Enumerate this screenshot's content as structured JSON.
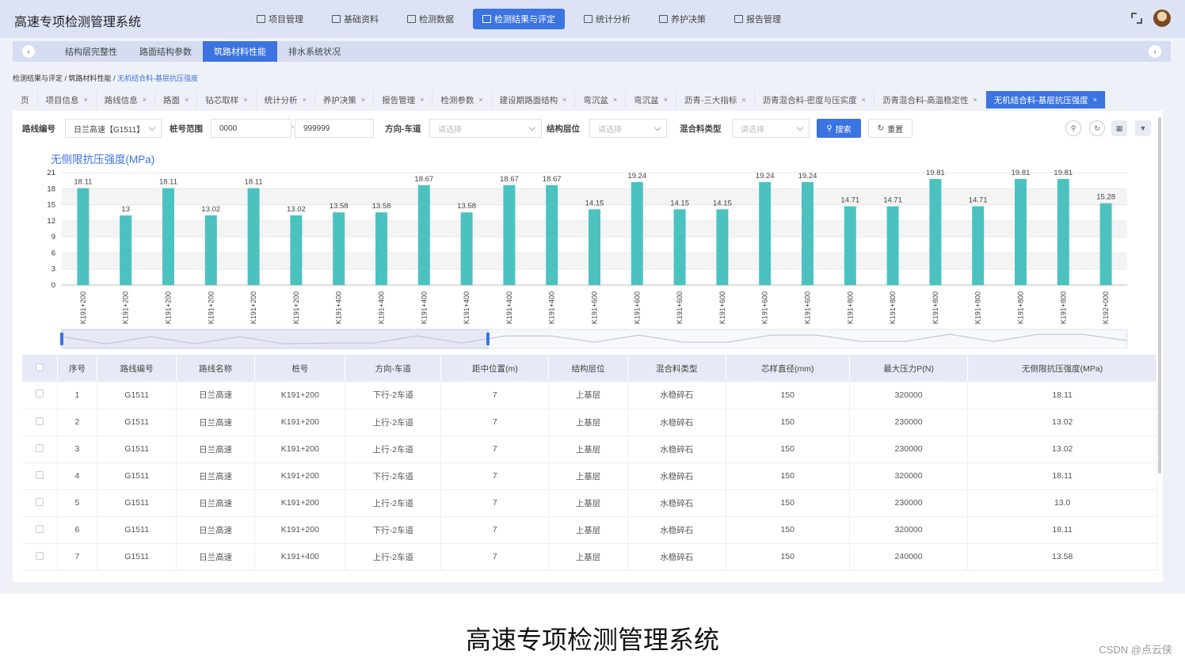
{
  "app": {
    "title": "高速专项检测管理系统",
    "nav": [
      {
        "label": "项目管理"
      },
      {
        "label": "基础资料"
      },
      {
        "label": "检测数据"
      },
      {
        "label": "检测结果与评定",
        "active": true
      },
      {
        "label": "统计分析"
      },
      {
        "label": "养护决策"
      },
      {
        "label": "报告管理"
      }
    ]
  },
  "subnav": {
    "tabs": [
      {
        "label": "结构层完整性"
      },
      {
        "label": "路面结构参数"
      },
      {
        "label": "筑路材料性能",
        "active": true
      },
      {
        "label": "排水系统状况"
      }
    ]
  },
  "breadcrumb": {
    "part1": "检测结果与评定",
    "part2": "筑路材料性能",
    "current": "无机结合料-基层抗压强度",
    "sep": " / "
  },
  "page_tabs": [
    {
      "label": "页",
      "closable": false
    },
    {
      "label": "项目信息"
    },
    {
      "label": "路线信息"
    },
    {
      "label": "路面"
    },
    {
      "label": "钻芯取样"
    },
    {
      "label": "统计分析"
    },
    {
      "label": "养护决策"
    },
    {
      "label": "报告管理"
    },
    {
      "label": "检测参数"
    },
    {
      "label": "建设期路面结构"
    },
    {
      "label": "弯沉盆"
    },
    {
      "label": "弯沉盆"
    },
    {
      "label": "沥青-三大指标"
    },
    {
      "label": "沥青混合料-密度与压实度"
    },
    {
      "label": "沥青混合料-高温稳定性"
    },
    {
      "label": "无机结合料-基层抗压强度",
      "active": true
    }
  ],
  "filters": {
    "route_label": "路线编号",
    "route_value": "日兰高速【G1511】",
    "stake_label": "桩号范围",
    "stake_from": "0000",
    "stake_to": "999999",
    "stake_dash": "-",
    "direction_label": "方向-车道",
    "direction_placeholder": "请选择",
    "layer_label": "结构层位",
    "layer_placeholder": "请选择",
    "mix_label": "混合料类型",
    "mix_placeholder": "请选择",
    "search_label": "搜索",
    "reset_label": "重置"
  },
  "chart_data": {
    "type": "bar",
    "title": "无侧限抗压强度(MPa)",
    "color": "#4cc2c0",
    "ylim": [
      0,
      21
    ],
    "yticks": [
      0,
      3,
      6,
      9,
      12,
      15,
      18,
      21
    ],
    "grid": true,
    "categories": [
      "K191+200",
      "K191+200",
      "K191+200",
      "K191+200",
      "K191+200",
      "K191+200",
      "K191+400",
      "K191+400",
      "K191+400",
      "K191+400",
      "K191+400",
      "K191+400",
      "K191+600",
      "K191+600",
      "K191+600",
      "K191+600",
      "K191+600",
      "K191+600",
      "K191+800",
      "K191+800",
      "K191+800",
      "K191+800",
      "K191+800",
      "K191+800",
      "K192+000"
    ],
    "values": [
      18.11,
      13,
      18.11,
      13.02,
      18.11,
      13.02,
      13.58,
      13.58,
      18.67,
      13.58,
      18.67,
      18.67,
      14.15,
      19.24,
      14.15,
      14.15,
      19.24,
      19.24,
      14.71,
      14.71,
      19.81,
      14.71,
      19.81,
      19.81,
      15.28
    ],
    "labels": [
      "18.11",
      "13",
      "18.11",
      "13.02",
      "18.11",
      "13.02",
      "13.58",
      "13.58",
      "18.67",
      "13.58",
      "18.67",
      "18.67",
      "14.15",
      "19.24",
      "14.15",
      "14.15",
      "19.24",
      "19.24",
      "14.71",
      "14.71",
      "19.81",
      "14.71",
      "19.81",
      "19.81",
      "15.28"
    ],
    "datazoom_range": [
      0,
      0.4
    ]
  },
  "table": {
    "columns": [
      "序号",
      "路线编号",
      "路线名称",
      "桩号",
      "方向-车道",
      "距中位置(m)",
      "结构层位",
      "混合料类型",
      "芯样直径(mm)",
      "最大压力P(N)",
      "无侧限抗压强度(MPa)"
    ],
    "rows": [
      [
        "1",
        "G1511",
        "日兰高速",
        "K191+200",
        "下行-2车道",
        "7",
        "上基层",
        "水稳碎石",
        "150",
        "320000",
        "18.11"
      ],
      [
        "2",
        "G1511",
        "日兰高速",
        "K191+200",
        "上行-2车道",
        "7",
        "上基层",
        "水稳碎石",
        "150",
        "230000",
        "13.02"
      ],
      [
        "3",
        "G1511",
        "日兰高速",
        "K191+200",
        "上行-2车道",
        "7",
        "上基层",
        "水稳碎石",
        "150",
        "230000",
        "13.02"
      ],
      [
        "4",
        "G1511",
        "日兰高速",
        "K191+200",
        "下行-2车道",
        "7",
        "上基层",
        "水稳碎石",
        "150",
        "320000",
        "18.11"
      ],
      [
        "5",
        "G1511",
        "日兰高速",
        "K191+200",
        "上行-2车道",
        "7",
        "上基层",
        "水稳碎石",
        "150",
        "230000",
        "13.0"
      ],
      [
        "6",
        "G1511",
        "日兰高速",
        "K191+200",
        "下行-2车道",
        "7",
        "上基层",
        "水稳碎石",
        "150",
        "320000",
        "18.11"
      ],
      [
        "7",
        "G1511",
        "日兰高速",
        "K191+400",
        "上行-2车道",
        "7",
        "上基层",
        "水稳碎石",
        "150",
        "240000",
        "13.58"
      ]
    ]
  },
  "caption": "高速专项检测管理系统",
  "watermark": "CSDN @点云侠"
}
